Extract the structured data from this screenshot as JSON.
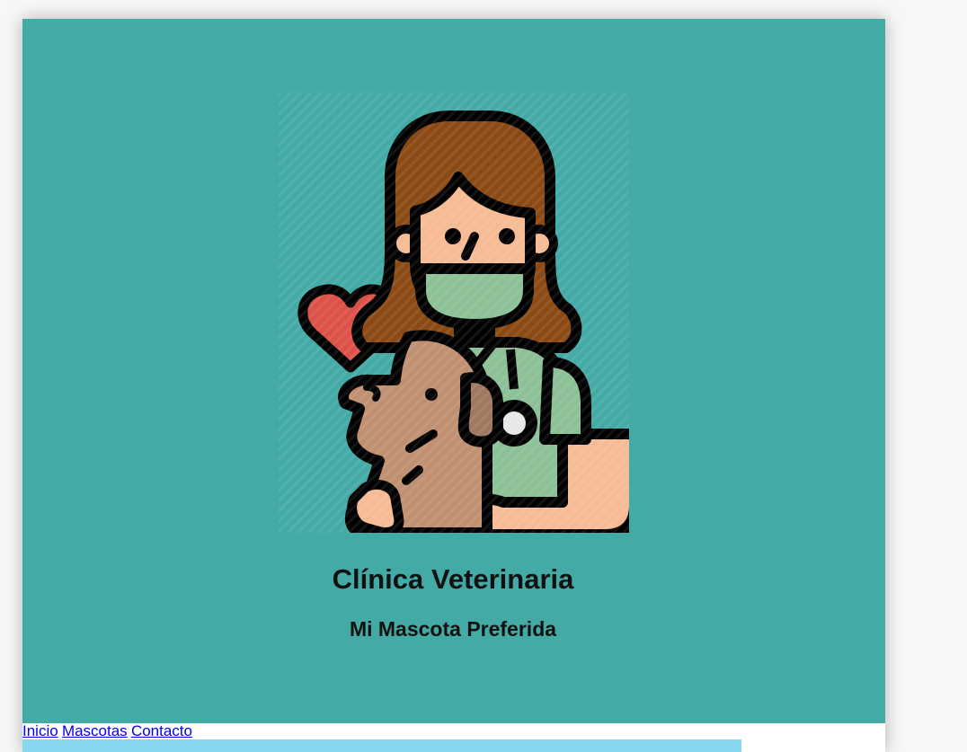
{
  "header": {
    "title": "Clínica Veterinaria",
    "subtitle": "Mi Mascota Preferida",
    "logo_icon": "veterinarian-with-dog-icon",
    "background_color": "#44aaa6"
  },
  "nav": {
    "items": [
      {
        "label": "Inicio"
      },
      {
        "label": "Mascotas"
      },
      {
        "label": "Contacto"
      }
    ],
    "link_color": "#0000ee"
  },
  "content": {
    "bar_color": "#87d7f0"
  }
}
